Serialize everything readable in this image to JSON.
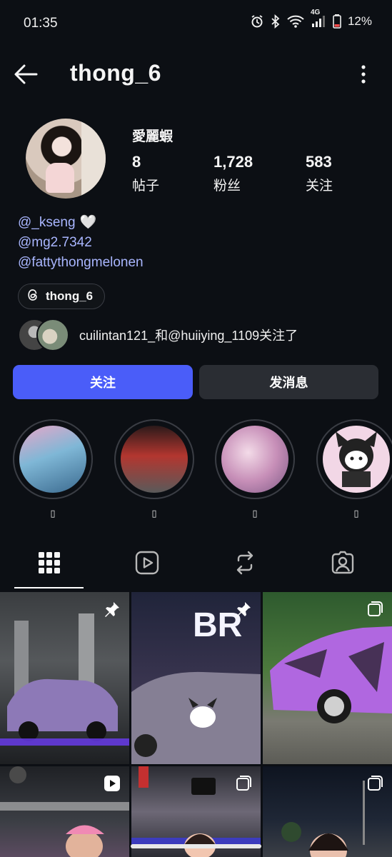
{
  "status_bar": {
    "time": "01:35",
    "network_label": "4G",
    "battery": "12%",
    "icons": [
      "alarm-icon",
      "bluetooth-icon",
      "wifi-icon",
      "signal-icon",
      "battery-icon"
    ]
  },
  "header": {
    "username": "thong_6"
  },
  "profile": {
    "display_name": "愛麗蝦",
    "stats": [
      {
        "value": "8",
        "label": "帖子"
      },
      {
        "value": "1,728",
        "label": "粉丝"
      },
      {
        "value": "583",
        "label": "关注"
      }
    ],
    "links": [
      {
        "text": "@_kseng",
        "suffix": "🤍"
      },
      {
        "text": "@mg2.7342",
        "suffix": ""
      },
      {
        "text": "@fattythongmelonen",
        "suffix": ""
      }
    ],
    "threads_handle": "thong_6",
    "mutual_text": "cuilintan121_和@huiiying_1109关注了"
  },
  "actions": {
    "follow": "关注",
    "message": "发消息"
  },
  "highlights": [
    {
      "label": "▯"
    },
    {
      "label": "▯"
    },
    {
      "label": "▯"
    },
    {
      "label": "▯"
    }
  ],
  "tabs": [
    "grid-icon",
    "reels-icon",
    "repost-icon",
    "tagged-icon"
  ],
  "colors": {
    "background": "#0c0f14",
    "accent": "#4a5df9",
    "link": "#a9b6ff",
    "secondary_button": "#2a2d33"
  }
}
